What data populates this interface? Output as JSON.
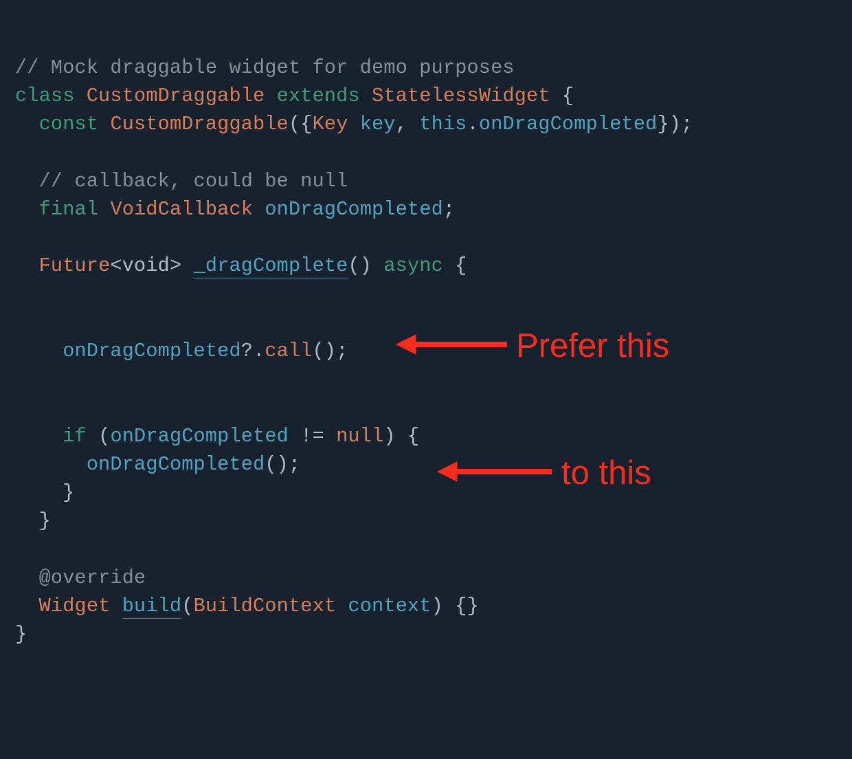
{
  "code": {
    "l1": {
      "a": "// Mock draggable widget for demo purposes"
    },
    "l2": {
      "a": "class",
      "b": " ",
      "c": "CustomDraggable",
      "d": " ",
      "e": "extends",
      "f": " ",
      "g": "StatelessWidget",
      "h": " {"
    },
    "l3": {
      "a": "  ",
      "b": "const",
      "c": " ",
      "d": "CustomDraggable",
      "e": "({",
      "f": "Key",
      "g": " ",
      "h": "key",
      "i": ", ",
      "j": "this",
      "k": ".",
      "l": "onDragCompleted",
      "m": "});"
    },
    "l5": {
      "a": "  ",
      "b": "// callback, could be null"
    },
    "l6": {
      "a": "  ",
      "b": "final",
      "c": " ",
      "d": "VoidCallback",
      "e": " ",
      "f": "onDragCompleted",
      "g": ";"
    },
    "l8": {
      "a": "  ",
      "b": "Future",
      "c": "<void> ",
      "d": "_dragComplete",
      "e": "() ",
      "f": "async",
      "g": " {"
    },
    "l11": {
      "a": "    ",
      "b": "onDragCompleted",
      "c": "?.",
      "d": "call",
      "e": "();"
    },
    "l14": {
      "a": "    ",
      "b": "if",
      "c": " (",
      "d": "onDragCompleted",
      "e": " != ",
      "f": "null",
      "g": ") {"
    },
    "l15": {
      "a": "      ",
      "b": "onDragCompleted",
      "c": "();"
    },
    "l16": {
      "a": "    }"
    },
    "l17": {
      "a": "  }"
    },
    "l19": {
      "a": "  ",
      "b": "@override"
    },
    "l20": {
      "a": "  ",
      "b": "Widget",
      "c": " ",
      "d": "build",
      "e": "(",
      "f": "BuildContext",
      "g": " ",
      "h": "context",
      "i": ") {}"
    },
    "l21": {
      "a": "}"
    }
  },
  "annotations": {
    "prefer": "Prefer this",
    "tothis": "to this"
  }
}
